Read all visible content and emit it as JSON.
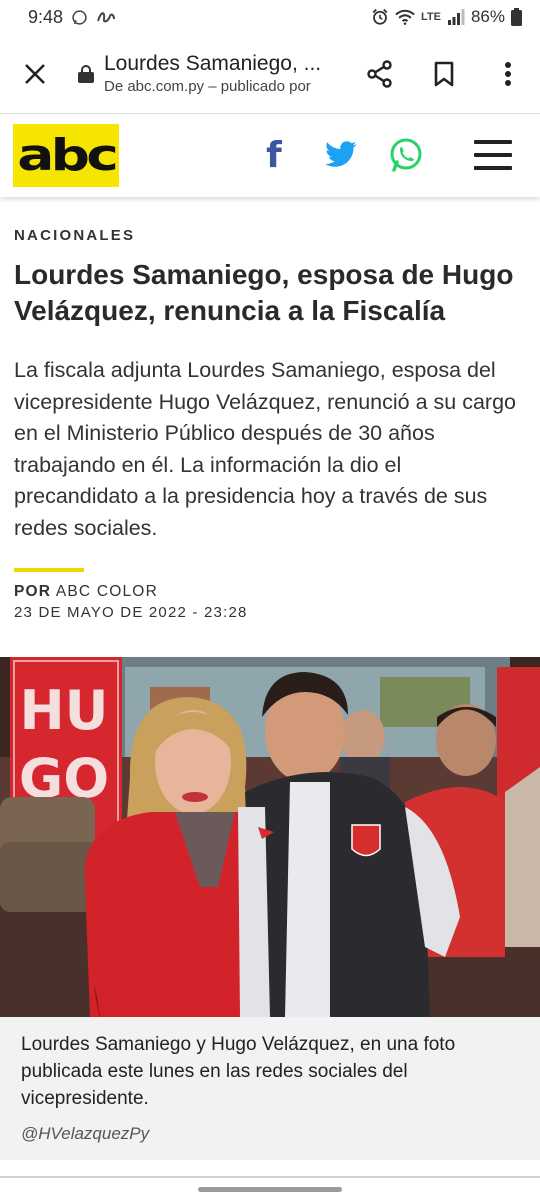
{
  "status_bar": {
    "time": "9:48",
    "lte_label": "LTE",
    "battery": "86%"
  },
  "toolbar": {
    "title": "Lourdes Samaniego, ...",
    "url_line": "De abc.com.py – publicado por"
  },
  "site_header": {
    "logo_text": "abc",
    "social": [
      "facebook",
      "twitter",
      "whatsapp"
    ]
  },
  "article": {
    "section": "NACIONALES",
    "headline": "Lourdes Samaniego, esposa de Hugo Velázquez, renuncia a la Fiscalía",
    "lede": "La fiscala adjunta Lourdes Samaniego, esposa del vicepresidente Hugo Velázquez, renunció a su cargo en el Ministerio Público después de 30 años trabajando en él. La información la dio el precandidato a la presidencia hoy a través de sus redes sociales.",
    "byline_prefix": "POR",
    "author": "ABC COLOR",
    "date": "23 DE MAYO DE 2022 - 23:28"
  },
  "photo": {
    "banner_text_1": "HU",
    "banner_text_2": "GO",
    "caption": "Lourdes Samaniego y Hugo Velázquez, en una foto publicada este lunes en las redes sociales del vicepresidente.",
    "credit": "@HVelazquezPy"
  },
  "colors": {
    "brand_yellow": "#f5e500",
    "byline_rule": "#f2d600",
    "facebook": "#3a57a0",
    "twitter": "#1da1f2",
    "whatsapp": "#25d366"
  }
}
